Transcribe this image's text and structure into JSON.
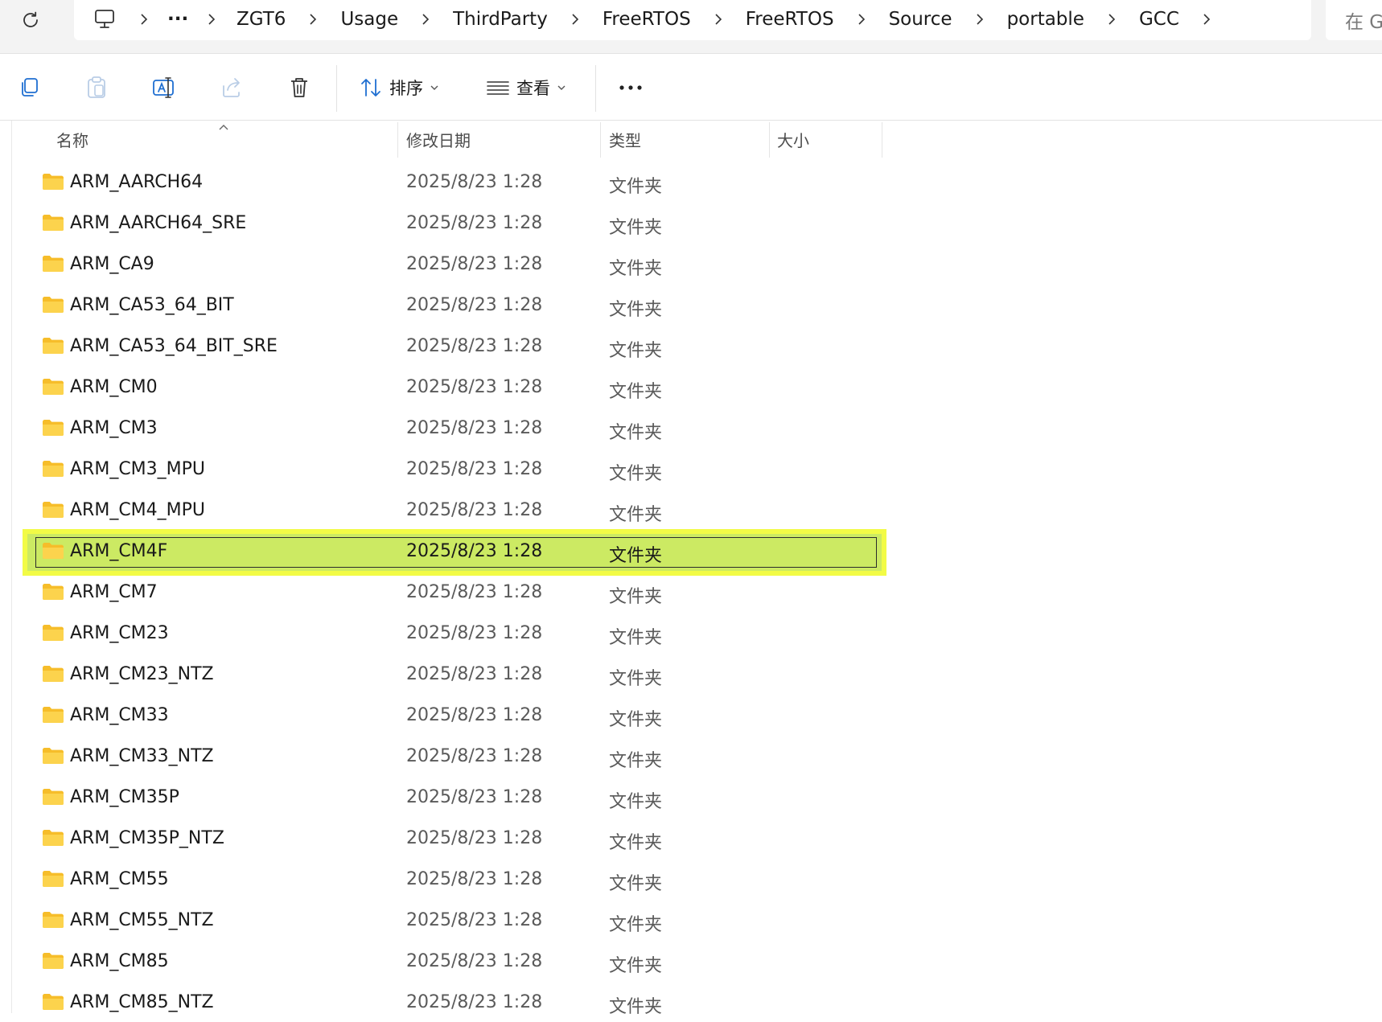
{
  "address": {
    "breadcrumbs": [
      "ZGT6",
      "Usage",
      "ThirdParty",
      "FreeRTOS",
      "FreeRTOS",
      "Source",
      "portable",
      "GCC"
    ],
    "overflow_label": "···",
    "search_placeholder": "在 G"
  },
  "toolbar": {
    "sort_label": "排序",
    "view_label": "查看"
  },
  "columns": {
    "name": "名称",
    "modified": "修改日期",
    "type": "类型",
    "size": "大小"
  },
  "files": [
    {
      "name": "ARM_AARCH64",
      "modified": "2025/8/23 1:28",
      "type": "文件夹"
    },
    {
      "name": "ARM_AARCH64_SRE",
      "modified": "2025/8/23 1:28",
      "type": "文件夹"
    },
    {
      "name": "ARM_CA9",
      "modified": "2025/8/23 1:28",
      "type": "文件夹"
    },
    {
      "name": "ARM_CA53_64_BIT",
      "modified": "2025/8/23 1:28",
      "type": "文件夹"
    },
    {
      "name": "ARM_CA53_64_BIT_SRE",
      "modified": "2025/8/23 1:28",
      "type": "文件夹"
    },
    {
      "name": "ARM_CM0",
      "modified": "2025/8/23 1:28",
      "type": "文件夹"
    },
    {
      "name": "ARM_CM3",
      "modified": "2025/8/23 1:28",
      "type": "文件夹"
    },
    {
      "name": "ARM_CM3_MPU",
      "modified": "2025/8/23 1:28",
      "type": "文件夹"
    },
    {
      "name": "ARM_CM4_MPU",
      "modified": "2025/8/23 1:28",
      "type": "文件夹"
    },
    {
      "name": "ARM_CM4F",
      "modified": "2025/8/23 1:28",
      "type": "文件夹",
      "selected": true
    },
    {
      "name": "ARM_CM7",
      "modified": "2025/8/23 1:28",
      "type": "文件夹"
    },
    {
      "name": "ARM_CM23",
      "modified": "2025/8/23 1:28",
      "type": "文件夹"
    },
    {
      "name": "ARM_CM23_NTZ",
      "modified": "2025/8/23 1:28",
      "type": "文件夹"
    },
    {
      "name": "ARM_CM33",
      "modified": "2025/8/23 1:28",
      "type": "文件夹"
    },
    {
      "name": "ARM_CM33_NTZ",
      "modified": "2025/8/23 1:28",
      "type": "文件夹"
    },
    {
      "name": "ARM_CM35P",
      "modified": "2025/8/23 1:28",
      "type": "文件夹"
    },
    {
      "name": "ARM_CM35P_NTZ",
      "modified": "2025/8/23 1:28",
      "type": "文件夹"
    },
    {
      "name": "ARM_CM55",
      "modified": "2025/8/23 1:28",
      "type": "文件夹"
    },
    {
      "name": "ARM_CM55_NTZ",
      "modified": "2025/8/23 1:28",
      "type": "文件夹"
    },
    {
      "name": "ARM_CM85",
      "modified": "2025/8/23 1:28",
      "type": "文件夹"
    },
    {
      "name": "ARM_CM85_NTZ",
      "modified": "2025/8/23 1:28",
      "type": "文件夹"
    }
  ],
  "colors": {
    "selection_fill": "#ccea63",
    "selection_highlight": "#f2fb46",
    "folder": "#f8c73b",
    "accent": "#1f6fd1"
  }
}
